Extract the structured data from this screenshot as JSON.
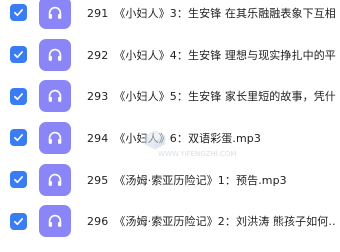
{
  "files": [
    {
      "num": "291",
      "name": "《小妇人》3：生安锋 在其乐融融表象下互相..."
    },
    {
      "num": "292",
      "name": "《小妇人》4：生安锋 理想与现实挣扎中的平..."
    },
    {
      "num": "293",
      "name": "《小妇人》5：生安锋 家长里短的故事，凭什..."
    },
    {
      "num": "294",
      "name": "《小妇人》6：双语彩蛋.mp3"
    },
    {
      "num": "295",
      "name": "《汤姆·索亚历险记》1：预告.mp3"
    },
    {
      "num": "296",
      "name": "《汤姆·索亚历险记》2：刘洪涛 熊孩子如何..."
    }
  ],
  "icons": {
    "checkbox": "check-icon",
    "file": "headphones-icon"
  },
  "colors": {
    "checkbox": "#3a7cf4",
    "file_icon_bg": "#8b86f8",
    "text": "#222222"
  },
  "watermark": {
    "text": "WWW.YIFENGZHI.COM"
  }
}
